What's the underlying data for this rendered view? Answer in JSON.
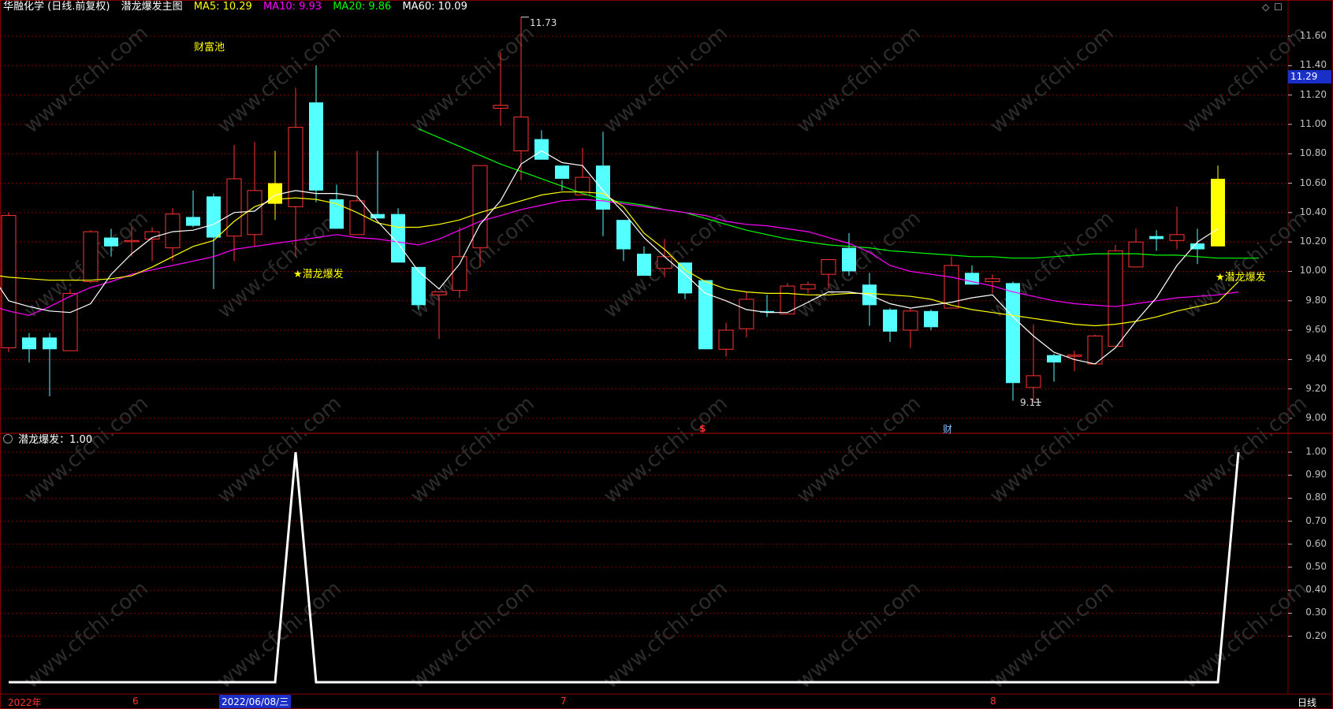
{
  "header": {
    "stock_title": "华融化学 (日线.前复权)",
    "indicator_name": "潜龙爆发主图",
    "ma5": "MA5: 10.29",
    "ma10": "MA10: 9.93",
    "ma20": "MA20: 9.86",
    "ma60": "MA60: 10.09"
  },
  "top_panel": {
    "label_caifuchi": "财富池",
    "signal_label_1": "★潜龙爆发",
    "signal_label_2": "★潜龙爆发",
    "high_marker": "11.73",
    "low_marker": "9.11",
    "price_tag": "11.29",
    "marker_dollar": "$",
    "marker_cai": "财",
    "price_ticks": [
      "11.60",
      "11.40",
      "11.20",
      "11.00",
      "10.80",
      "10.60",
      "10.40",
      "10.20",
      "10.00",
      "9.80",
      "9.60",
      "9.40",
      "9.20",
      "9.00"
    ]
  },
  "bottom_panel": {
    "title": "潜龙爆发：1.00",
    "ticks": [
      "1.00",
      "0.90",
      "0.80",
      "0.70",
      "0.60",
      "0.50",
      "0.40",
      "0.30",
      "0.20"
    ]
  },
  "bottom_bar": {
    "date_labels": [
      "2022年",
      "6",
      "2022/06/08/三",
      "7",
      "8"
    ],
    "period_label": "日线"
  },
  "watermark": "www.cfchi.com",
  "colors": {
    "up": "#ff3232",
    "down": "#54ffff",
    "signal": "#ffff00",
    "ma5": "#ffffff",
    "ma10": "#ffff00",
    "ma20": "#ff00ff",
    "ma60": "#00ff00",
    "grid": "#7f0000"
  },
  "chart_data": {
    "type": "candlestick",
    "candles": [
      {
        "o": 9.48,
        "h": 10.4,
        "l": 9.45,
        "c": 10.38
      },
      {
        "o": 9.55,
        "h": 9.58,
        "l": 9.38,
        "c": 9.47
      },
      {
        "o": 9.55,
        "h": 9.58,
        "l": 9.15,
        "c": 9.47
      },
      {
        "o": 9.46,
        "h": 9.88,
        "l": 9.46,
        "c": 9.85
      },
      {
        "o": 9.93,
        "h": 10.28,
        "l": 9.92,
        "c": 10.27
      },
      {
        "o": 10.23,
        "h": 10.29,
        "l": 10.1,
        "c": 10.17
      },
      {
        "o": 10.21,
        "h": 10.3,
        "l": 10.1,
        "c": 10.21
      },
      {
        "o": 10.22,
        "h": 10.3,
        "l": 10.07,
        "c": 10.27
      },
      {
        "o": 10.16,
        "h": 10.43,
        "l": 10.07,
        "c": 10.39
      },
      {
        "o": 10.37,
        "h": 10.55,
        "l": 10.3,
        "c": 10.31
      },
      {
        "o": 10.51,
        "h": 10.53,
        "l": 9.88,
        "c": 10.23
      },
      {
        "o": 10.24,
        "h": 10.86,
        "l": 10.07,
        "c": 10.63
      },
      {
        "o": 10.25,
        "h": 10.88,
        "l": 10.17,
        "c": 10.55
      },
      {
        "o": 10.46,
        "h": 10.82,
        "l": 10.35,
        "c": 10.6
      },
      {
        "o": 10.44,
        "h": 11.25,
        "l": 10.1,
        "c": 10.98
      },
      {
        "o": 11.15,
        "h": 11.4,
        "l": 10.47,
        "c": 10.55
      },
      {
        "o": 10.49,
        "h": 10.59,
        "l": 10.29,
        "c": 10.29
      },
      {
        "o": 10.25,
        "h": 10.82,
        "l": 10.25,
        "c": 10.48
      },
      {
        "o": 10.39,
        "h": 10.82,
        "l": 10.37,
        "c": 10.36
      },
      {
        "o": 10.39,
        "h": 10.43,
        "l": 10.06,
        "c": 10.06
      },
      {
        "o": 10.03,
        "h": 10.03,
        "l": 9.74,
        "c": 9.77
      },
      {
        "o": 9.84,
        "h": 9.86,
        "l": 9.54,
        "c": 9.86
      },
      {
        "o": 9.87,
        "h": 10.3,
        "l": 9.82,
        "c": 10.1
      },
      {
        "o": 10.16,
        "h": 10.58,
        "l": 10.03,
        "c": 10.72
      },
      {
        "o": 11.11,
        "h": 11.49,
        "l": 10.99,
        "c": 11.13
      },
      {
        "o": 10.82,
        "h": 11.73,
        "l": 10.62,
        "c": 11.05
      },
      {
        "o": 10.9,
        "h": 10.96,
        "l": 10.77,
        "c": 10.76
      },
      {
        "o": 10.72,
        "h": 10.62,
        "l": 10.55,
        "c": 10.63
      },
      {
        "o": 10.52,
        "h": 10.84,
        "l": 10.52,
        "c": 10.64
      },
      {
        "o": 10.72,
        "h": 10.95,
        "l": 10.24,
        "c": 10.42
      },
      {
        "o": 10.35,
        "h": 10.35,
        "l": 10.07,
        "c": 10.15
      },
      {
        "o": 10.12,
        "h": 10.17,
        "l": 9.97,
        "c": 9.97
      },
      {
        "o": 10.02,
        "h": 10.22,
        "l": 9.96,
        "c": 10.1
      },
      {
        "o": 10.06,
        "h": 10.06,
        "l": 9.81,
        "c": 9.85
      },
      {
        "o": 9.94,
        "h": 9.94,
        "l": 9.47,
        "c": 9.47
      },
      {
        "o": 9.47,
        "h": 9.65,
        "l": 9.42,
        "c": 9.6
      },
      {
        "o": 9.61,
        "h": 9.86,
        "l": 9.55,
        "c": 9.81
      },
      {
        "o": 9.73,
        "h": 9.84,
        "l": 9.69,
        "c": 9.72
      },
      {
        "o": 9.71,
        "h": 9.92,
        "l": 9.71,
        "c": 9.9
      },
      {
        "o": 9.88,
        "h": 9.93,
        "l": 9.85,
        "c": 9.91
      },
      {
        "o": 9.98,
        "h": 10.07,
        "l": 9.88,
        "c": 10.08
      },
      {
        "o": 10.16,
        "h": 10.26,
        "l": 9.97,
        "c": 10.0
      },
      {
        "o": 9.91,
        "h": 9.99,
        "l": 9.63,
        "c": 9.77
      },
      {
        "o": 9.74,
        "h": 9.75,
        "l": 9.52,
        "c": 9.59
      },
      {
        "o": 9.6,
        "h": 9.75,
        "l": 9.48,
        "c": 9.73
      },
      {
        "o": 9.73,
        "h": 9.74,
        "l": 9.6,
        "c": 9.62
      },
      {
        "o": 9.75,
        "h": 10.1,
        "l": 9.75,
        "c": 10.04
      },
      {
        "o": 9.99,
        "h": 10.04,
        "l": 9.91,
        "c": 9.91
      },
      {
        "o": 9.93,
        "h": 9.98,
        "l": 9.85,
        "c": 9.95
      },
      {
        "o": 9.92,
        "h": 9.93,
        "l": 9.12,
        "c": 9.24
      },
      {
        "o": 9.21,
        "h": 9.64,
        "l": 9.11,
        "c": 9.29
      },
      {
        "o": 9.43,
        "h": 9.44,
        "l": 9.25,
        "c": 9.38
      },
      {
        "o": 9.43,
        "h": 9.46,
        "l": 9.32,
        "c": 9.43
      },
      {
        "o": 9.37,
        "h": 9.57,
        "l": 9.37,
        "c": 9.56
      },
      {
        "o": 9.49,
        "h": 10.18,
        "l": 9.49,
        "c": 10.14
      },
      {
        "o": 10.03,
        "h": 10.29,
        "l": 10.03,
        "c": 10.2
      },
      {
        "o": 10.24,
        "h": 10.28,
        "l": 10.14,
        "c": 10.22
      },
      {
        "o": 10.21,
        "h": 10.44,
        "l": 10.15,
        "c": 10.25
      },
      {
        "o": 10.19,
        "h": 10.29,
        "l": 10.05,
        "c": 10.15
      },
      {
        "o": 10.17,
        "h": 10.72,
        "l": 10.17,
        "c": 10.63
      }
    ],
    "signal_candle_indices": [
      13,
      59
    ],
    "ma5": [
      10.01,
      9.8,
      9.76,
      9.73,
      9.72,
      9.78,
      9.98,
      10.12,
      10.23,
      10.27,
      10.28,
      10.32,
      10.4,
      10.41,
      10.52,
      10.55,
      10.53,
      10.53,
      10.51,
      10.34,
      10.19,
      10.0,
      9.88,
      10.05,
      10.32,
      10.48,
      10.73,
      10.82,
      10.74,
      10.72,
      10.55,
      10.4,
      10.23,
      10.1,
      9.98,
      9.85,
      9.8,
      9.74,
      9.72,
      9.72,
      9.79,
      9.86,
      9.86,
      9.84,
      9.78,
      9.75,
      9.77,
      9.79,
      9.82,
      9.84,
      9.69,
      9.56,
      9.45,
      9.4,
      9.37,
      9.48,
      9.66,
      9.82,
      10.04,
      10.2,
      10.29
    ],
    "ma10": [
      9.98,
      9.96,
      9.95,
      9.94,
      9.94,
      9.94,
      9.95,
      9.97,
      10.03,
      10.1,
      10.17,
      10.21,
      10.34,
      10.44,
      10.49,
      10.5,
      10.49,
      10.46,
      10.4,
      10.33,
      10.3,
      10.3,
      10.32,
      10.35,
      10.4,
      10.44,
      10.48,
      10.52,
      10.54,
      10.54,
      10.53,
      10.44,
      10.26,
      10.15,
      10.01,
      9.93,
      9.88,
      9.86,
      9.85,
      9.85,
      9.84,
      9.84,
      9.85,
      9.85,
      9.84,
      9.83,
      9.81,
      9.77,
      9.74,
      9.72,
      9.7,
      9.68,
      9.66,
      9.64,
      9.63,
      9.64,
      9.66,
      9.69,
      9.73,
      9.76,
      9.79,
      9.93
    ],
    "ma20": [
      9.77,
      9.73,
      9.7,
      9.76,
      9.83,
      9.89,
      9.93,
      9.98,
      10.01,
      10.04,
      10.07,
      10.1,
      10.15,
      10.17,
      10.19,
      10.21,
      10.23,
      10.25,
      10.23,
      10.22,
      10.2,
      10.18,
      10.22,
      10.28,
      10.34,
      10.38,
      10.42,
      10.45,
      10.48,
      10.49,
      10.48,
      10.46,
      10.44,
      10.42,
      10.4,
      10.38,
      10.34,
      10.32,
      10.31,
      10.29,
      10.27,
      10.23,
      10.19,
      10.13,
      10.04,
      10.0,
      9.98,
      9.96,
      9.93,
      9.9,
      9.86,
      9.83,
      9.8,
      9.78,
      9.77,
      9.76,
      9.78,
      9.8,
      9.82,
      9.83,
      9.84,
      9.86
    ],
    "ma60": [
      10.97,
      10.91,
      10.85,
      10.79,
      10.73,
      10.68,
      10.63,
      10.58,
      10.53,
      10.49,
      10.47,
      10.45,
      10.42,
      10.4,
      10.36,
      10.32,
      10.28,
      10.25,
      10.22,
      10.2,
      10.18,
      10.17,
      10.16,
      10.14,
      10.13,
      10.12,
      10.11,
      10.1,
      10.1,
      10.09,
      10.09,
      10.1,
      10.11,
      10.12,
      10.12,
      10.12,
      10.11,
      10.11,
      10.1,
      10.09,
      10.09,
      10.09
    ],
    "indicator": [
      0,
      0,
      0,
      0,
      0,
      0,
      0,
      0,
      0,
      0,
      0,
      0,
      0,
      0,
      1,
      0,
      0,
      0,
      0,
      0,
      0,
      0,
      0,
      0,
      0,
      0,
      0,
      0,
      0,
      0,
      0,
      0,
      0,
      0,
      0,
      0,
      0,
      0,
      0,
      0,
      0,
      0,
      0,
      0,
      0,
      0,
      0,
      0,
      0,
      0,
      0,
      0,
      0,
      0,
      0,
      0,
      0,
      0,
      0,
      0,
      1
    ],
    "ylim_price": [
      9.0,
      11.73
    ],
    "ylim_indicator": [
      0,
      1
    ]
  }
}
